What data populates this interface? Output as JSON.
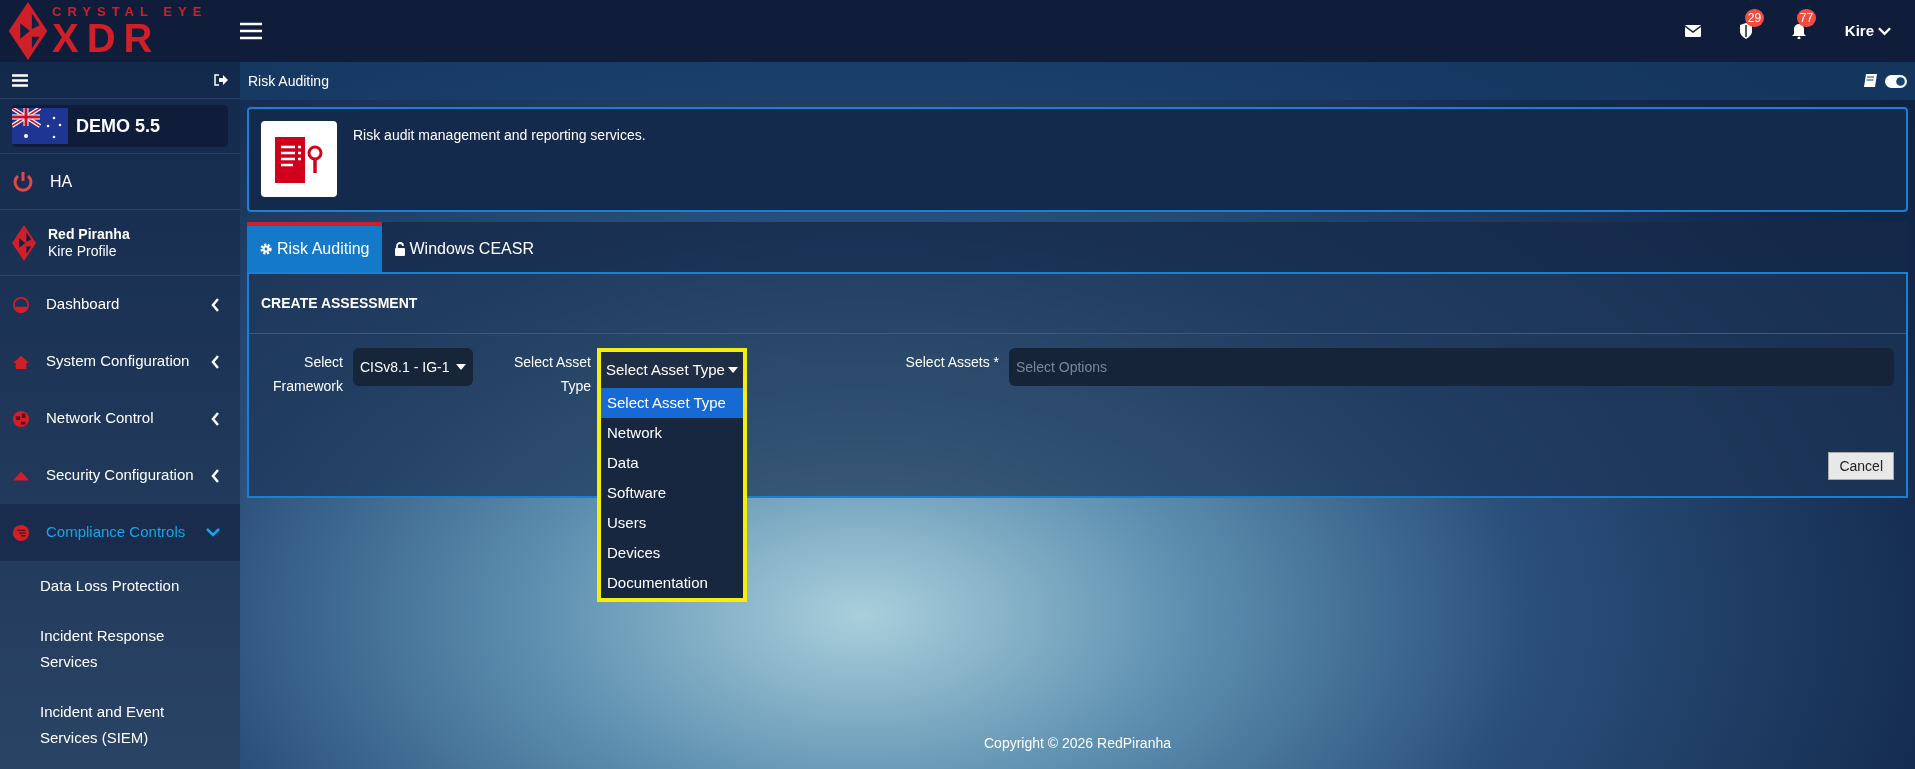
{
  "logo": {
    "top": "CRYSTAL EYE",
    "bottom": "XDR"
  },
  "topbar": {
    "badges": [
      {
        "kind": "mail"
      },
      {
        "kind": "shield",
        "count": "29"
      },
      {
        "kind": "bell",
        "count": "77"
      }
    ],
    "user": "Kire"
  },
  "sidebar": {
    "device": "DEMO 5.5",
    "ha": "HA",
    "profile": {
      "org": "Red Piranha",
      "name": "Kire Profile"
    },
    "items": [
      {
        "label": "Dashboard",
        "kind": "gauge",
        "expanded": false
      },
      {
        "label": "System Configuration",
        "kind": "home",
        "expanded": false
      },
      {
        "label": "Network Control",
        "kind": "globe",
        "expanded": false
      },
      {
        "label": "Security Configuration",
        "kind": "warning",
        "expanded": false
      },
      {
        "label": "Compliance Controls",
        "kind": "badge",
        "expanded": true,
        "children": [
          {
            "label": "Data Loss Protection"
          },
          {
            "label": "Incident Response Services"
          },
          {
            "label": "Incident and Event Services (SIEM)"
          }
        ]
      }
    ]
  },
  "breadcrumb": "Risk Auditing",
  "intro": "Risk audit management and reporting services.",
  "tabs": [
    {
      "label": "Risk Auditing",
      "kind": "gear",
      "selected": true
    },
    {
      "label": "Windows CEASR",
      "kind": "unlock",
      "selected": false
    }
  ],
  "panel": {
    "title": "CREATE ASSESSMENT",
    "framework": {
      "label": "Select Framework",
      "value": "CISv8.1 - IG-1"
    },
    "asset_type": {
      "label": "Select Asset Type",
      "value": "Select Asset Type",
      "options": [
        {
          "label": "Select Asset Type",
          "selected": true
        },
        {
          "label": "Network",
          "selected": false
        },
        {
          "label": "Data",
          "selected": false
        },
        {
          "label": "Software",
          "selected": false
        },
        {
          "label": "Users",
          "selected": false
        },
        {
          "label": "Devices",
          "selected": false
        },
        {
          "label": "Documentation",
          "selected": false
        }
      ]
    },
    "assets": {
      "label": "Select Assets *",
      "placeholder": "Select Options"
    },
    "cancel": "Cancel"
  },
  "footer": "Copyright © 2026 RedPiranha"
}
